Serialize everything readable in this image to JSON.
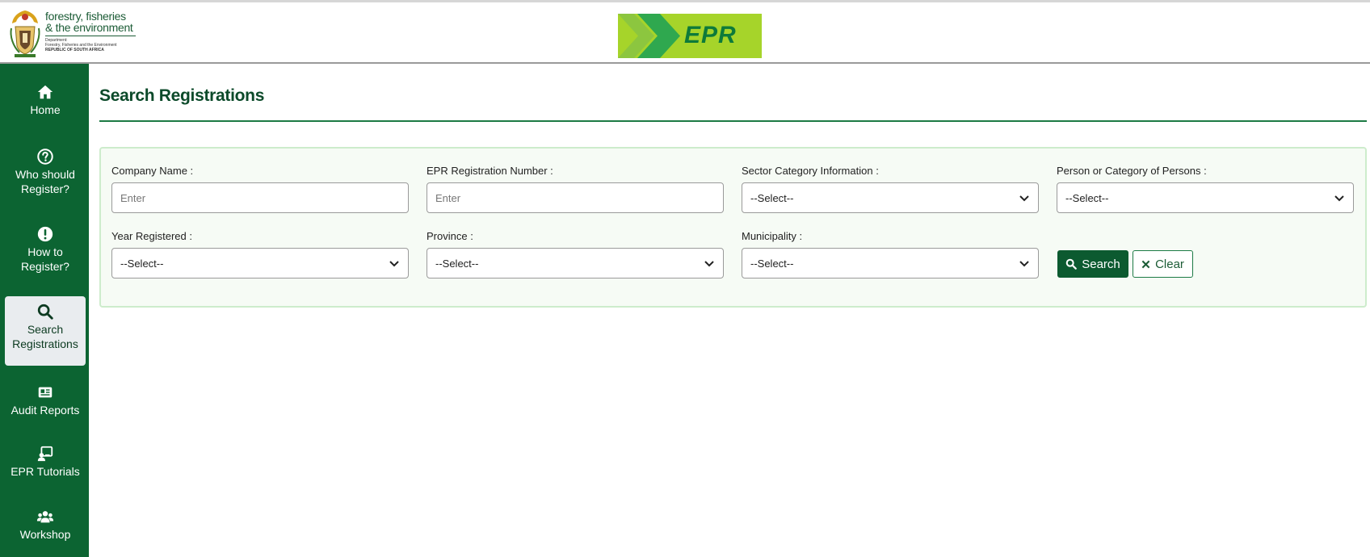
{
  "header": {
    "dept_line1": "forestry, fisheries",
    "dept_line2": "& the environment",
    "dept_small1": "Department:",
    "dept_small2": "Forestry, Fisheries and the Environment",
    "dept_small3": "REPUBLIC OF SOUTH AFRICA",
    "epr_logo_text": "EPR"
  },
  "sidebar": {
    "items": [
      {
        "label": "Home",
        "icon": "home-icon"
      },
      {
        "label": "Who should Register?",
        "icon": "question-circle-icon"
      },
      {
        "label": "How to Register?",
        "icon": "exclamation-circle-icon"
      },
      {
        "label": "Search Registrations",
        "icon": "search-icon",
        "active": true
      },
      {
        "label": "Audit Reports",
        "icon": "report-icon"
      },
      {
        "label": "EPR Tutorials",
        "icon": "tutorial-icon"
      },
      {
        "label": "Workshop",
        "icon": "users-icon"
      }
    ]
  },
  "page": {
    "title": "Search Registrations"
  },
  "form": {
    "company_name": {
      "label": "Company Name :",
      "placeholder": "Enter"
    },
    "epr_number": {
      "label": "EPR Registration Number :",
      "placeholder": "Enter"
    },
    "sector": {
      "label": "Sector Category Information :",
      "value": "--Select--"
    },
    "person": {
      "label": "Person or Category of Persons :",
      "value": "--Select--"
    },
    "year": {
      "label": "Year Registered :",
      "value": "--Select--"
    },
    "province": {
      "label": "Province :",
      "value": "--Select--"
    },
    "municipality": {
      "label": "Municipality :",
      "value": "--Select--"
    },
    "search_label": "Search",
    "clear_label": "Clear"
  },
  "colors": {
    "sidebar_bg": "#0c6432",
    "accent": "#0c5a30",
    "epr_logo_bg": "#a6d42a"
  }
}
